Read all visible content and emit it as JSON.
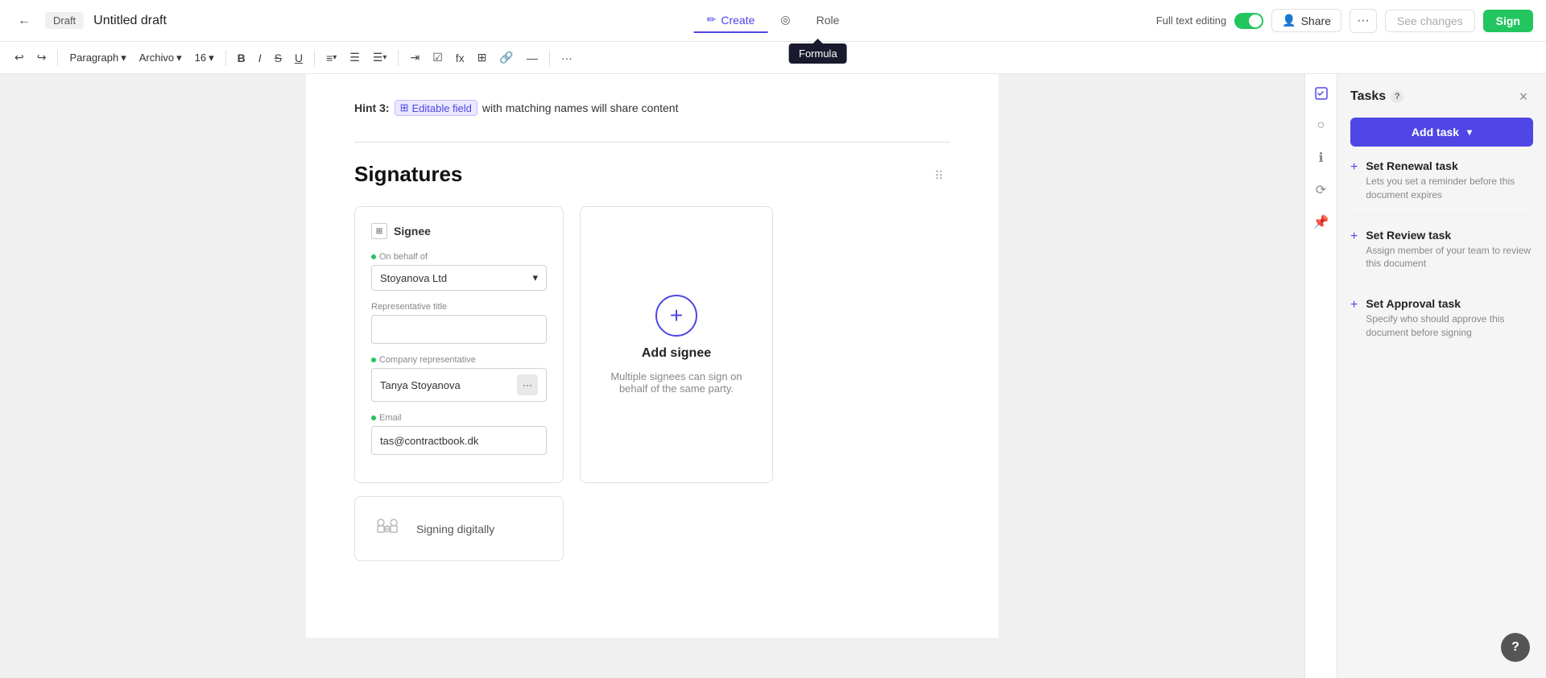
{
  "topbar": {
    "back_icon": "←",
    "draft_label": "Draft",
    "doc_title": "Untitled draft",
    "tabs": [
      {
        "id": "create",
        "label": "Create",
        "icon": "✏️",
        "active": true
      },
      {
        "id": "formula",
        "label": "Formula",
        "tooltip": "Formula"
      },
      {
        "id": "role",
        "label": "Role",
        "active": false
      }
    ],
    "full_text_label": "Full text editing",
    "share_label": "Share",
    "more_icon": "···",
    "see_changes_label": "See changes",
    "sign_label": "Sign"
  },
  "toolbar": {
    "undo": "↩",
    "redo": "↪",
    "paragraph_label": "Paragraph",
    "font_label": "Archivo",
    "size_label": "16",
    "bold": "B",
    "italic": "I",
    "strikethrough": "S",
    "underline": "U",
    "align": "≡",
    "list_bullet": "≡",
    "list_number": "≡",
    "more": "···"
  },
  "hint": {
    "label": "Hint 3:",
    "field_icon": "⊞",
    "field_label": "Editable field",
    "text": "with matching names will share content"
  },
  "signatures": {
    "title": "Signatures",
    "signee": {
      "title": "Signee",
      "on_behalf_label": "On behalf of",
      "on_behalf_value": "Stoyanova Ltd",
      "rep_title_label": "Representative title",
      "rep_title_value": "",
      "company_rep_label": "Company representative",
      "company_rep_value": "Tanya Stoyanova",
      "email_label": "Email",
      "email_value": "tas@contractbook.dk",
      "signing_label": "Signing digitally"
    },
    "add_signee": {
      "plus_icon": "+",
      "title": "Add signee",
      "description": "Multiple signees can sign on behalf of the same party."
    }
  },
  "tasks": {
    "title": "Tasks",
    "info_icon": "?",
    "close_icon": "×",
    "add_task_label": "Add task",
    "chevron": "▾",
    "items": [
      {
        "title": "Set Renewal task",
        "description": "Lets you set a reminder before this document expires"
      },
      {
        "title": "Set Review task",
        "description": "Assign member of your team to review this document"
      },
      {
        "title": "Set Approval task",
        "description": "Specify who should approve this document before signing"
      }
    ]
  },
  "help": {
    "icon": "?"
  }
}
